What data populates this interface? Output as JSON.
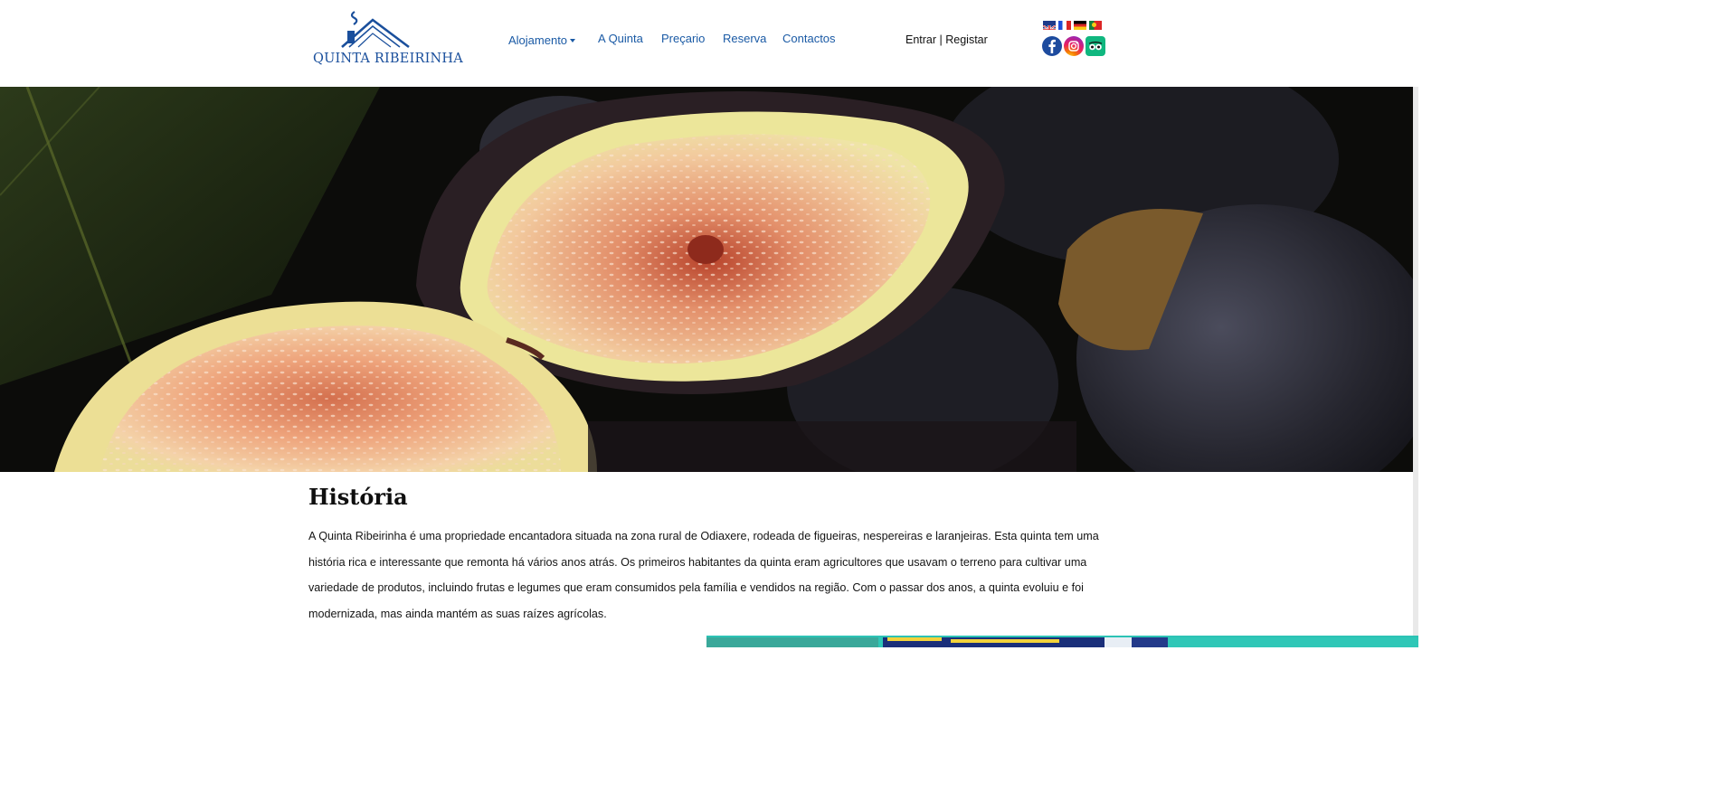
{
  "brand": {
    "name": "QUINTA RIBEIRINHA",
    "color": "#1a4f9c"
  },
  "nav": {
    "items": [
      {
        "label": "Alojamento",
        "has_dropdown": true
      },
      {
        "label": "A Quinta"
      },
      {
        "label": "Preçario"
      },
      {
        "label": "Reserva"
      },
      {
        "label": "Contactos"
      }
    ],
    "color": "#1a5aa5"
  },
  "auth": {
    "login": "Entrar",
    "separator": " | ",
    "register": "Registar"
  },
  "languages": [
    {
      "icon": "flag-uk-icon"
    },
    {
      "icon": "flag-france-icon"
    },
    {
      "icon": "flag-germany-icon"
    },
    {
      "icon": "flag-portugal-icon"
    }
  ],
  "social": [
    {
      "icon": "facebook-icon",
      "color": "#1d4b9e"
    },
    {
      "icon": "instagram-icon"
    },
    {
      "icon": "tripadvisor-icon",
      "color": "#10b77f"
    }
  ],
  "hero": {
    "image": "figs-photo"
  },
  "history": {
    "title": "História",
    "body": "A Quinta Ribeirinha é uma propriedade encantadora situada na zona rural de Odiaxere, rodeada de figueiras, nespereiras e laranjeiras. Esta quinta tem uma história rica e interessante que remonta há vários anos atrás. Os primeiros habitantes da quinta eram agricultores que usavam o terreno para cultivar uma variedade de produtos, incluindo frutas e legumes que eram consumidos pela família e vendidos na região. Com o passar dos anos, a quinta evoluiu e foi modernizada, mas ainda mantém as suas raízes agrícolas."
  },
  "boat_image": {
    "image": "boat-photo"
  }
}
